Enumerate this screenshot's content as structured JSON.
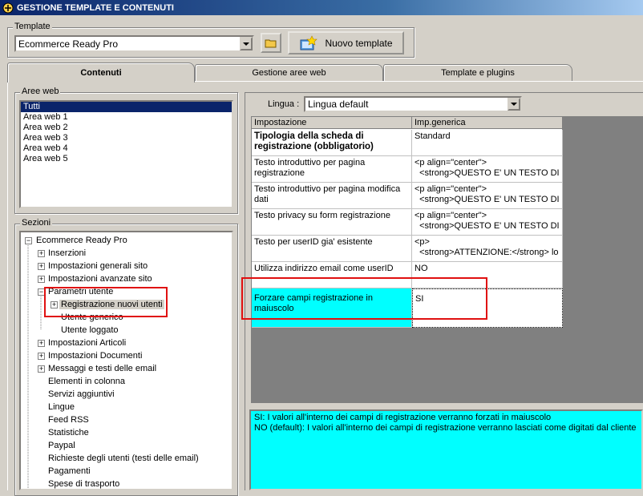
{
  "window": {
    "title": "GESTIONE TEMPLATE E CONTENUTI"
  },
  "template_group": {
    "label": "Template",
    "selected": "Ecommerce Ready Pro",
    "new_button_label": "Nuovo template"
  },
  "tabs": [
    {
      "label": "Contenuti",
      "active": true
    },
    {
      "label": "Gestione aree web",
      "active": false
    },
    {
      "label": "Template e plugins",
      "active": false
    }
  ],
  "aree_web": {
    "label": "Aree web",
    "items": [
      "Tutti",
      "Area web 1",
      "Area web 2",
      "Area web 3",
      "Area web 4",
      "Area web 5"
    ],
    "selected_index": 0
  },
  "sezioni": {
    "label": "Sezioni",
    "tree": [
      {
        "label": "Ecommerce Ready Pro",
        "expander": "minus"
      },
      {
        "label": "Inserzioni",
        "expander": "plus"
      },
      {
        "label": "Impostazioni generali sito",
        "expander": "plus"
      },
      {
        "label": "Impostazioni avanzate sito",
        "expander": "plus"
      },
      {
        "label": "Parametri utente",
        "expander": "minus"
      },
      {
        "label": "Registrazione nuovi utenti",
        "expander": "plus"
      },
      {
        "label": "Utente generico",
        "expander": ""
      },
      {
        "label": "Utente loggato",
        "expander": ""
      },
      {
        "label": "Impostazioni Articoli",
        "expander": "plus"
      },
      {
        "label": "Impostazioni Documenti",
        "expander": "plus"
      },
      {
        "label": "Messaggi e testi delle email",
        "expander": "plus"
      },
      {
        "label": "Elementi in colonna",
        "expander": ""
      },
      {
        "label": "Servizi aggiuntivi",
        "expander": ""
      },
      {
        "label": "Lingue",
        "expander": ""
      },
      {
        "label": "Feed RSS",
        "expander": ""
      },
      {
        "label": "Statistiche",
        "expander": ""
      },
      {
        "label": "Paypal",
        "expander": ""
      },
      {
        "label": "Richieste degli utenti (testi delle email)",
        "expander": ""
      },
      {
        "label": "Pagamenti",
        "expander": ""
      },
      {
        "label": "Spese di trasporto",
        "expander": ""
      }
    ]
  },
  "lingua": {
    "label": "Lingua :",
    "selected": "Lingua default"
  },
  "grid": {
    "headers": [
      "Impostazione",
      "Imp.generica"
    ],
    "rows": [
      {
        "setting": "Tipologia della scheda di registrazione (obbligatorio)",
        "value": "Standard",
        "bold": true
      },
      {
        "setting": "Testo introduttivo per pagina registrazione",
        "value": "<p align=\"center\">\n  <strong>QUESTO E' UN TESTO DI"
      },
      {
        "setting": "Testo introduttivo per pagina modifica dati",
        "value": "<p align=\"center\">\n  <strong>QUESTO E' UN TESTO DI"
      },
      {
        "setting": "Testo privacy su form registrazione",
        "value": "<p align=\"center\">\n  <strong>QUESTO E' UN TESTO DI"
      },
      {
        "setting": "Testo per userID gia' esistente",
        "value": "<p>\n  <strong>ATTENZIONE:</strong> lo"
      },
      {
        "setting": "Utilizza indirizzo email come userID",
        "value": "NO"
      },
      {
        "setting": "Forzare campi registrazione in maiuscolo",
        "value": "SI",
        "selected": true
      }
    ]
  },
  "description": {
    "line1": "SI: I valori all'interno dei campi di registrazione verranno forzati in maiuscolo",
    "line2": "NO (default):  I valori all'interno dei campi di registrazione verranno lasciati come digitati dal cliente"
  },
  "colors": {
    "selection": "#00ffff",
    "highlight": "#e01010",
    "title_start": "#0a246a"
  }
}
